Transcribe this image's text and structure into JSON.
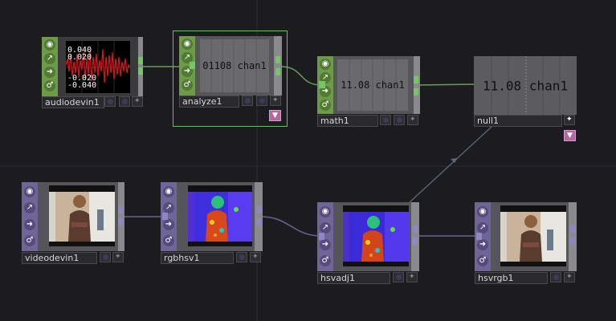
{
  "nodes": {
    "audiodevin1": {
      "name": "audiodevin1",
      "scope_labels": [
        "0.040",
        "0.020",
        "-0.020",
        "-0.040"
      ]
    },
    "analyze1": {
      "name": "analyze1",
      "value": "01108 chan1"
    },
    "math1": {
      "name": "math1",
      "value": "11.08 chan1"
    },
    "null1": {
      "name": "null1",
      "value": "11.08 chan1"
    },
    "videodevin1": {
      "name": "videodevin1"
    },
    "rgbhsv1": {
      "name": "rgbhsv1"
    },
    "hsvadj1": {
      "name": "hsvadj1"
    },
    "hsvrgb1": {
      "name": "hsvrgb1"
    }
  },
  "icons": {
    "side_strip": [
      "bypass-icon",
      "cook-icon",
      "display-arrow-icon",
      "clone-icon"
    ],
    "flag": "down-arrow-flag-icon"
  },
  "colors": {
    "chop_family": "#6e9b4a",
    "top_family": "#6f6596",
    "chop_wire": "#79c36a",
    "top_wire": "#8f86c4",
    "selected_outline": "#2ee62e",
    "export_flag": "#b06a9e"
  }
}
